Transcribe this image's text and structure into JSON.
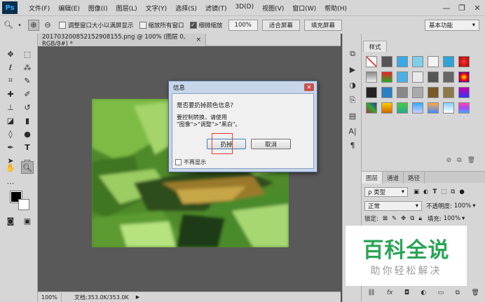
{
  "app": {
    "logo": "Ps"
  },
  "menu": [
    "文件(F)",
    "编辑(E)",
    "图像(I)",
    "图层(L)",
    "文字(Y)",
    "选择(S)",
    "滤镜(T)",
    "3D(D)",
    "视图(V)",
    "窗口(W)",
    "帮助(H)"
  ],
  "window_controls": {
    "minimize": "—",
    "restore": "❐",
    "close": "✕"
  },
  "options": {
    "resize_windows": "调整窗口大小以满屏显示",
    "zoom_all": "缩放所有窗口",
    "scrubby_zoom": "细微缩放",
    "zoom_value": "100%",
    "fit_screen": "适合屏幕",
    "fill_screen": "填充屏幕",
    "workspace": "基本功能"
  },
  "document": {
    "tab_title": "20170320085215290815​5.png @ 100% (图层 0, RGB/8#) *",
    "close": "×"
  },
  "status": {
    "zoom": "100%",
    "doc_info": "文档:353.0K/353.0K",
    "arrow": "▶"
  },
  "styles_panel": {
    "tab": "样式"
  },
  "layers_panel": {
    "tabs": [
      "图层",
      "通道",
      "路径"
    ],
    "filter": "ρ 类型",
    "blend_mode": "正常",
    "opacity_label": "不透明度:",
    "opacity_value": "100%",
    "lock_label": "锁定:",
    "fill_label": "填充:",
    "fill_value": "100%"
  },
  "dialog": {
    "title": "信息",
    "close": "✕",
    "question": "是否要扔掉颜色信息?",
    "line1": "要控制转换，请使用",
    "line2": "\"图像\">\"调整\">\"黑白\"。",
    "discard": "扔掉",
    "cancel": "取消",
    "dont_show": "不再显示"
  },
  "watermark": {
    "main": "百科全说",
    "sub": "助你轻松解决"
  }
}
